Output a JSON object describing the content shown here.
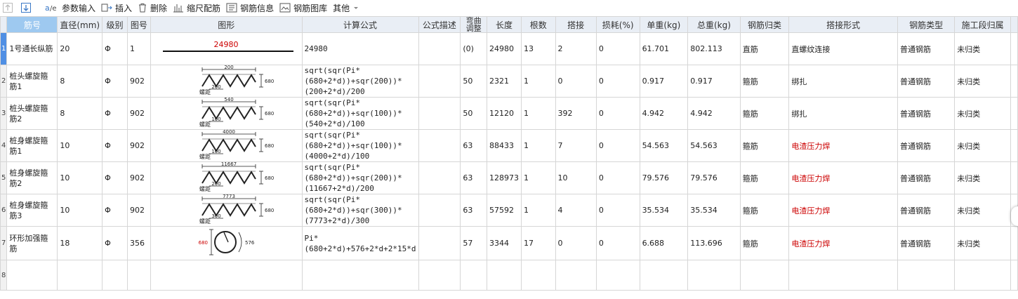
{
  "toolbar": {
    "up": "",
    "down": "",
    "param_input": "参数输入",
    "insert": "插入",
    "delete": "删除",
    "scale_rebar": "缩尺配筋",
    "rebar_info": "钢筋信息",
    "rebar_library": "钢筋图库",
    "other": "其他"
  },
  "columns": [
    "筋号",
    "直径(mm)",
    "级别",
    "图号",
    "图形",
    "计算公式",
    "公式描述",
    "弯曲调整",
    "长度",
    "根数",
    "搭接",
    "损耗(%)",
    "单重(kg)",
    "总重(kg)",
    "钢筋归类",
    "搭接形式",
    "钢筋类型",
    "施工段归属"
  ],
  "rows": [
    {
      "num": "1",
      "name": "1号通长纵筋",
      "dia": "20",
      "grade": "Φ",
      "fig": "1",
      "shape": {
        "kind": "straight",
        "label": "24980"
      },
      "formula": "24980",
      "desc": "",
      "bend": "(0)",
      "length": "24980",
      "count": "13",
      "lap": "2",
      "loss": "0",
      "unit_w": "61.701",
      "total_w": "802.113",
      "category": "直筋",
      "lap_type": "直螺纹连接",
      "lap_red": false,
      "type": "普通钢筋",
      "stage": "未归类"
    },
    {
      "num": "2",
      "name": "桩头螺旋箍筋1",
      "dia": "8",
      "grade": "Φ",
      "fig": "902",
      "shape": {
        "kind": "spiral",
        "top": "200",
        "pitch": "200",
        "side": "680",
        "pitch_label": "螺距"
      },
      "formula": "sqrt(sqr(Pi*(680+2*d))+sqr(200))*(200+2*d)/200",
      "desc": "",
      "bend": "50",
      "length": "2321",
      "count": "1",
      "lap": "0",
      "loss": "0",
      "unit_w": "0.917",
      "total_w": "0.917",
      "category": "箍筋",
      "lap_type": "绑扎",
      "lap_red": false,
      "type": "普通钢筋",
      "stage": "未归类"
    },
    {
      "num": "3",
      "name": "桩头螺旋箍筋2",
      "dia": "8",
      "grade": "Φ",
      "fig": "902",
      "shape": {
        "kind": "spiral",
        "top": "540",
        "pitch": "100",
        "side": "680",
        "pitch_label": "螺距"
      },
      "formula": "sqrt(sqr(Pi*(680+2*d))+sqr(100))*(540+2*d)/100",
      "desc": "",
      "bend": "50",
      "length": "12120",
      "count": "1",
      "lap": "392",
      "loss": "0",
      "unit_w": "4.942",
      "total_w": "4.942",
      "category": "箍筋",
      "lap_type": "绑扎",
      "lap_red": false,
      "type": "普通钢筋",
      "stage": "未归类"
    },
    {
      "num": "4",
      "name": "桩身螺旋箍筋1",
      "dia": "10",
      "grade": "Φ",
      "fig": "902",
      "shape": {
        "kind": "spiral",
        "top": "4000",
        "pitch": "100",
        "side": "680",
        "pitch_label": "螺距"
      },
      "formula": "sqrt(sqr(Pi*(680+2*d))+sqr(100))*(4000+2*d)/100",
      "desc": "",
      "bend": "63",
      "length": "88433",
      "count": "1",
      "lap": "7",
      "loss": "0",
      "unit_w": "54.563",
      "total_w": "54.563",
      "category": "箍筋",
      "lap_type": "电渣压力焊",
      "lap_red": true,
      "type": "普通钢筋",
      "stage": "未归类"
    },
    {
      "num": "5",
      "name": "桩身螺旋箍筋2",
      "dia": "10",
      "grade": "Φ",
      "fig": "902",
      "shape": {
        "kind": "spiral",
        "top": "11667",
        "pitch": "200",
        "side": "680",
        "pitch_label": "螺距"
      },
      "formula": "sqrt(sqr(Pi*(680+2*d))+sqr(200))*(11667+2*d)/200",
      "desc": "",
      "bend": "63",
      "length": "128973",
      "count": "1",
      "lap": "10",
      "loss": "0",
      "unit_w": "79.576",
      "total_w": "79.576",
      "category": "箍筋",
      "lap_type": "电渣压力焊",
      "lap_red": true,
      "type": "普通钢筋",
      "stage": "未归类"
    },
    {
      "num": "6",
      "name": "桩身螺旋箍筋3",
      "dia": "10",
      "grade": "Φ",
      "fig": "902",
      "shape": {
        "kind": "spiral",
        "top": "7773",
        "pitch": "300",
        "side": "680",
        "pitch_label": "螺距"
      },
      "formula": "sqrt(sqr(Pi*(680+2*d))+sqr(300))*(7773+2*d)/300",
      "desc": "",
      "bend": "63",
      "length": "57592",
      "count": "1",
      "lap": "4",
      "loss": "0",
      "unit_w": "35.534",
      "total_w": "35.534",
      "category": "箍筋",
      "lap_type": "电渣压力焊",
      "lap_red": true,
      "type": "普通钢筋",
      "stage": "未归类"
    },
    {
      "num": "7",
      "name": "环形加强箍筋",
      "dia": "18",
      "grade": "Φ",
      "fig": "356",
      "shape": {
        "kind": "ring",
        "left": "680",
        "right": "576"
      },
      "formula": "Pi*(680+2*d)+576+2*d+2*15*d",
      "desc": "",
      "bend": "57",
      "length": "3344",
      "count": "17",
      "lap": "0",
      "loss": "0",
      "unit_w": "6.688",
      "total_w": "113.696",
      "category": "箍筋",
      "lap_type": "电渣压力焊",
      "lap_red": true,
      "type": "普通钢筋",
      "stage": "未归类"
    }
  ],
  "empty_row_num": "8",
  "colors": {
    "header_bg": "#e9eef5",
    "active_header": "#9ec9f0",
    "selected_row_num": "#4f8fe4",
    "red_text": "#cc0000"
  }
}
